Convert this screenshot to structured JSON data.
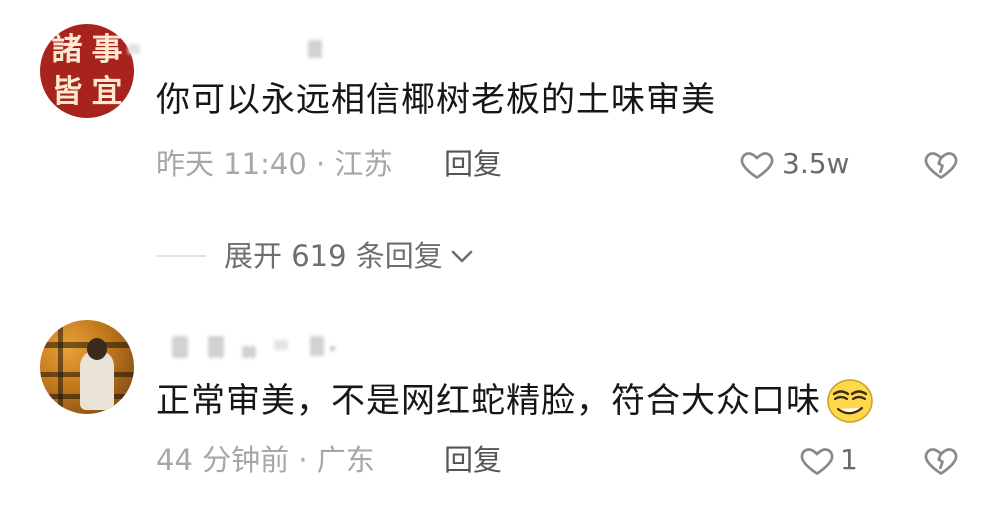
{
  "comments": [
    {
      "avatar_glyphs": [
        "諸",
        "事",
        "皆",
        "宜"
      ],
      "text": "你可以永远相信椰树老板的土味审美",
      "time_location": "昨天 11:40 · 江苏",
      "reply_label": "回复",
      "like_count": "3.5w",
      "expand_label": "展开 619 条回复"
    },
    {
      "text": "正常审美，不是网红蛇精脸，符合大众口味",
      "emoji": "smirk-emoji",
      "time_location": "44 分钟前 · 广东",
      "reply_label": "回复",
      "like_count": "1"
    }
  ],
  "icons": {
    "like": "heart-outline-icon",
    "dislike": "broken-heart-icon",
    "expand": "chevron-down-icon"
  }
}
